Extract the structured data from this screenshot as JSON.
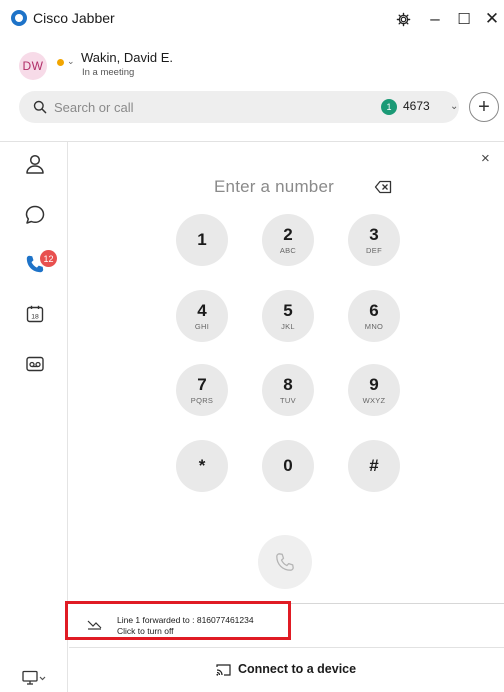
{
  "app": {
    "title": "Cisco Jabber"
  },
  "window_controls": {
    "settings": "⚙",
    "minimize": "–",
    "maximize": "☐",
    "close": "✕"
  },
  "profile": {
    "initials": "DW",
    "name": "Wakin, David E.",
    "status": "In a meeting",
    "status_color": "#f2a500"
  },
  "search": {
    "placeholder": "Search or call",
    "line_badge": "1",
    "line_number": "4673",
    "add_label": "+"
  },
  "sidebar": {
    "items": [
      {
        "name": "contacts",
        "icon": "person-icon"
      },
      {
        "name": "chat",
        "icon": "chat-bubble-icon"
      },
      {
        "name": "calls",
        "icon": "phone-icon",
        "badge": "12"
      },
      {
        "name": "meetings",
        "icon": "calendar-icon",
        "day": "18"
      },
      {
        "name": "voicemail",
        "icon": "voicemail-icon"
      }
    ],
    "device_icon": "monitor-icon"
  },
  "dialpad": {
    "close_label": "×",
    "placeholder": "Enter a number",
    "keys": [
      {
        "digit": "1",
        "letters": ""
      },
      {
        "digit": "2",
        "letters": "ABC"
      },
      {
        "digit": "3",
        "letters": "DEF"
      },
      {
        "digit": "4",
        "letters": "GHI"
      },
      {
        "digit": "5",
        "letters": "JKL"
      },
      {
        "digit": "6",
        "letters": "MNO"
      },
      {
        "digit": "7",
        "letters": "PQRS"
      },
      {
        "digit": "8",
        "letters": "TUV"
      },
      {
        "digit": "9",
        "letters": "WXYZ"
      },
      {
        "digit": "*",
        "letters": ""
      },
      {
        "digit": "0",
        "letters": ""
      },
      {
        "digit": "#",
        "letters": ""
      }
    ]
  },
  "forward": {
    "line1": "Line 1 forwarded to  : 816077461234",
    "line2": "Click to turn off",
    "highlight_color": "#e01b24"
  },
  "connect": {
    "label": "Connect to a device"
  },
  "colors": {
    "accent": "#1e73c8",
    "badge": "#e8504f",
    "line_badge": "#1b9a76"
  }
}
